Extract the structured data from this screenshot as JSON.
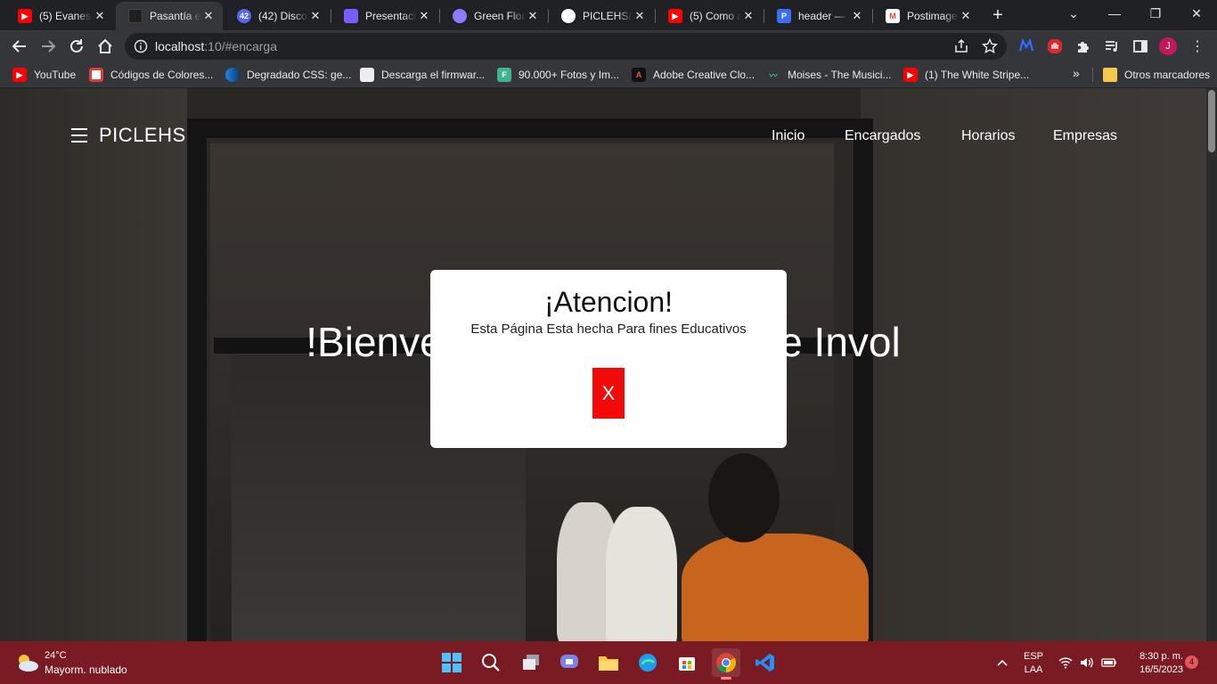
{
  "browser": {
    "tabs": [
      {
        "title": "(5) Evanesc",
        "icon": "youtube-icon",
        "color": "#ff0000"
      },
      {
        "title": "Pasantía e",
        "icon": "page-icon",
        "color": "#1f1f1f",
        "active": true
      },
      {
        "title": "(42) Discor",
        "icon": "discord-icon",
        "color": "#5865f2",
        "badge": "42"
      },
      {
        "title": "Presentaci",
        "icon": "presentation-icon",
        "color": "#7b5cff"
      },
      {
        "title": "Green Flor",
        "icon": "figma-icon",
        "color": "#8b7bff"
      },
      {
        "title": "PICLEHS/R",
        "icon": "github-icon",
        "color": "#ffffff"
      },
      {
        "title": "(5) Como a",
        "icon": "youtube-icon",
        "color": "#ff0000"
      },
      {
        "title": "header — (",
        "icon": "docs-icon",
        "color": "#3b6ef5"
      },
      {
        "title": "Postimage",
        "icon": "gmail-icon",
        "color": "#ea4335"
      }
    ],
    "address": {
      "host": "localhost",
      "rest": ":10/#encarga"
    },
    "profile_initial": "J",
    "bookmarks": [
      {
        "label": "YouTube",
        "icon": "youtube-icon",
        "color": "#ff0000"
      },
      {
        "label": "Códigos de Colores...",
        "icon": "color-codes-icon",
        "color": "#e53935"
      },
      {
        "label": "Degradado CSS: ge...",
        "icon": "gradient-icon",
        "color": "#1e88e5"
      },
      {
        "label": "Descarga el firmwar...",
        "icon": "firmware-icon",
        "color": "#eeeeee"
      },
      {
        "label": "90.000+ Fotos y Im...",
        "icon": "freepik-icon",
        "color": "#3fb28f"
      },
      {
        "label": "Adobe Creative Clo...",
        "icon": "adobe-icon",
        "color": "#111111"
      },
      {
        "label": "Moises - The Musici...",
        "icon": "moises-icon",
        "color": "#35c2c1"
      },
      {
        "label": "(1) The White Stripe...",
        "icon": "youtube-icon",
        "color": "#ff0000"
      }
    ],
    "bookmarks_overflow": "»",
    "other_bookmarks": "Otros marcadores"
  },
  "page": {
    "brand": "PICLEHS",
    "nav": [
      "Inicio",
      "Encargados",
      "Horarios",
      "Empresas"
    ],
    "hero_title": "!Bienvenidos a Pasantías e Invol",
    "modal": {
      "title": "¡Atencion!",
      "text": "Esta Página Esta hecha Para fines Educativos",
      "close_label": "X",
      "close_color": "#f20a0a"
    }
  },
  "taskbar": {
    "weather_temp": "24°C",
    "weather_desc": "Mayorm. nublado",
    "lang_1": "ESP",
    "lang_2": "LAA",
    "time": "8:30 p. m.",
    "date": "16/5/2023",
    "notifications": "4",
    "accent": "#7a1a22"
  }
}
